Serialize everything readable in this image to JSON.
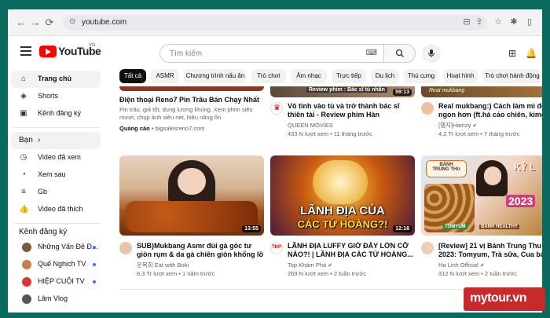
{
  "browser": {
    "url": "youtube.com",
    "back_icon": "arrow-left-icon",
    "forward_icon": "arrow-right-icon",
    "reload_icon": "reload-icon"
  },
  "header": {
    "logo_text": "YouTube",
    "country": "VN",
    "search_placeholder": "Tìm kiếm"
  },
  "sidebar": {
    "main": [
      {
        "label": "Trang chủ",
        "icon": "home-icon",
        "active": true
      },
      {
        "label": "Shorts",
        "icon": "shorts-icon"
      },
      {
        "label": "Kênh đăng ký",
        "icon": "subscriptions-icon"
      }
    ],
    "you_section": "Bạn",
    "you": [
      {
        "label": "Video đã xem",
        "icon": "history-icon"
      },
      {
        "label": "Xem sau",
        "icon": "watch-later-icon"
      },
      {
        "label": "Gb",
        "icon": "playlist-icon"
      },
      {
        "label": "Video đã thích",
        "icon": "like-icon"
      }
    ],
    "subs_section": "Kênh đăng ký",
    "subs": [
      {
        "label": "Những Vấn Đề Đ...",
        "color": "#7a5a3e"
      },
      {
        "label": "Quế Nghịch TV",
        "color": "#c97a4a"
      },
      {
        "label": "HIỆP CUỘI TV",
        "color": "#d33"
      },
      {
        "label": "Lâm Vlog",
        "color": "#555"
      }
    ]
  },
  "chips": [
    "Tất cả",
    "ASMR",
    "Chương trình nấu ăn",
    "Trò chơi",
    "Âm nhạc",
    "Trực tiếp",
    "Du lịch",
    "Thú cưng",
    "Hoạt hình",
    "Trò chơi hành động"
  ],
  "top_row": {
    "ad": {
      "title": "Điện thoại Reno7 Pin Trâu Bán Chạy Nhất",
      "desc1": "Pin trâu, giá tốt, dung lượng khủng. Xem phim siêu",
      "desc2": "mượt, chụp ảnh siêu nét, hiệu năng ổn",
      "ad_label": "Quảng cáo",
      "ad_url": "bigsalesreno7.com"
    },
    "video2": {
      "thumb_text": "Review phim : Bác sĩ tù nhân",
      "duration": "59:13",
      "title1": "Vô tình vào tù và trở thành bác sĩ",
      "title2": "thiên tài - Review phim Hàn",
      "channel": "QUEEN MOVIES",
      "meta": "433 N lượt xem • 11 tháng trước"
    },
    "video3": {
      "thumb_text": "Real mukbang",
      "title1": "Real mukbang:) Cách làm mì đen",
      "title2": "ngon hơn (ft.há cảo chiên, kimch",
      "channel": "[햄지]Hamzy",
      "meta": "4,2 Tr lượt xem • 7 tháng trước"
    }
  },
  "videos": [
    {
      "duration": "13:55",
      "title1": "SUB)Mukbang Asmr đùi gà góc tư",
      "title2": "giòn rụm & da gà chiên giòn khổng lồ",
      "channel": "운복희 Eat with Boki",
      "meta": "6,3 Tr lượt xem • 1 năm trước"
    },
    {
      "duration": "12:18",
      "thumb_line1": "LÃNH ĐỊA CỦA",
      "thumb_line2": "CÁC TỨ HOÀNG?!",
      "title1": "LÃNH ĐỊA LUFFY GIỜ ĐÂY LỚN CỠ",
      "title2": "NÀO?! | LÃNH ĐỊA CÁC TỨ HOÀNG...",
      "channel": "Top Khám Phá",
      "meta": "269 N lượt xem • 2 tuần trước"
    },
    {
      "thumb_line1": "BÁNH",
      "thumb_line2": "TRUNG THU",
      "thumb_tag": "KỶ L",
      "thumb_year": "2023",
      "thumb_b1": "TOMYUM",
      "thumb_b2": "BÁNH HEALTHY",
      "title1": "[Review] 21 vị Bánh Trung Thu KỶ L",
      "title2": "2023: Tomyum, Trà sữa, Cua bất l",
      "channel": "Ha Linh Official",
      "meta": "312 N lượt xem • 2 tuần trước"
    }
  ],
  "watermark": "mytour.vn"
}
